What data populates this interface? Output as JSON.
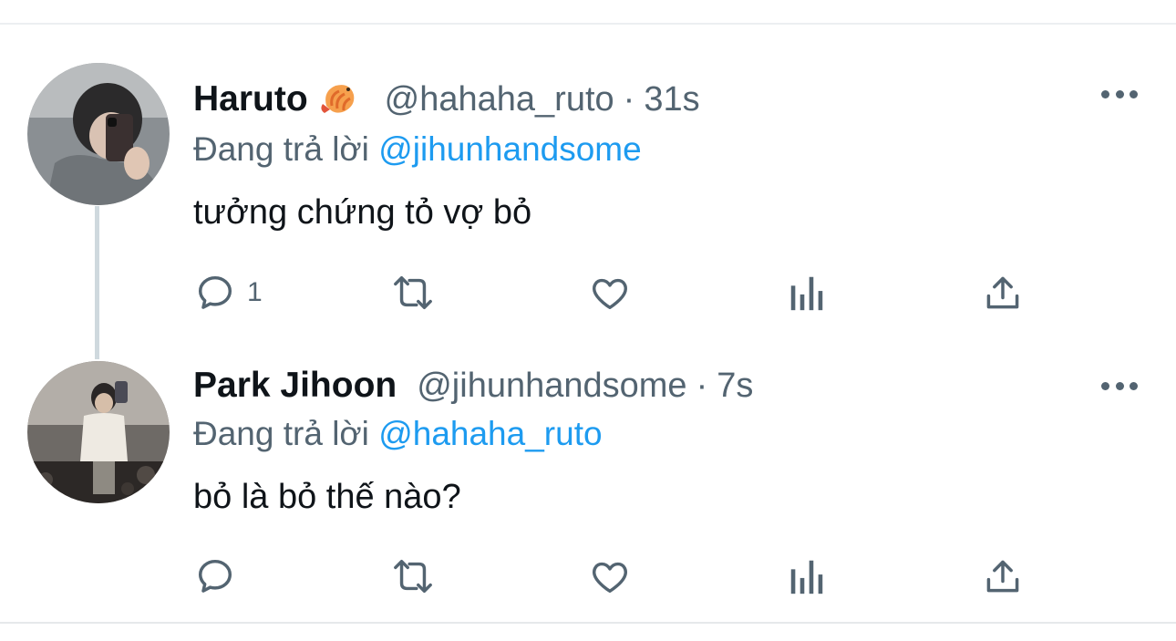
{
  "colors": {
    "accent": "#1d9bf0",
    "secondary_text": "#536471",
    "primary_text": "#0f1419",
    "thread_line": "#cfd9de"
  },
  "tweets": [
    {
      "display_name": "Haruto",
      "badge_icon": "shrimp-emoji-icon",
      "handle": "@hahaha_ruto",
      "separator": "·",
      "time": "31s",
      "replying_prefix": "Đang trả lời",
      "replying_to": "@jihunhandsome",
      "text": "tưởng chứng tỏ vợ bỏ",
      "reply_count": "1",
      "icons": [
        "reply-icon",
        "retweet-icon",
        "like-icon",
        "analytics-icon",
        "share-icon",
        "more-icon"
      ]
    },
    {
      "display_name": "Park Jihoon",
      "handle": "@jihunhandsome",
      "separator": "·",
      "time": "7s",
      "replying_prefix": "Đang trả lời",
      "replying_to": "@hahaha_ruto",
      "text": "bỏ là bỏ thế nào?",
      "reply_count": "",
      "icons": [
        "reply-icon",
        "retweet-icon",
        "like-icon",
        "analytics-icon",
        "share-icon",
        "more-icon"
      ]
    }
  ]
}
